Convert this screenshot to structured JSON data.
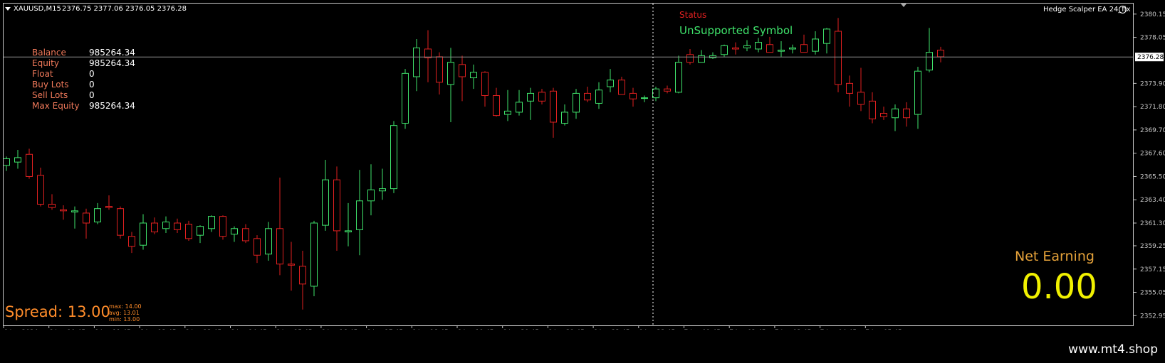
{
  "header": {
    "symbol_timeframe": "XAUUSD,M15",
    "ohlc": "2376.75 2377.06 2376.05 2376.28",
    "ea_name": "Hedge Scalper EA 24_fix"
  },
  "account": {
    "rows": [
      {
        "label": "Balance",
        "value": "985264.34"
      },
      {
        "label": "Equity",
        "value": "985264.34"
      },
      {
        "label": "Float",
        "value": "0"
      },
      {
        "label": "Buy Lots",
        "value": "0"
      },
      {
        "label": "Sell Lots",
        "value": "0"
      },
      {
        "label": "Max Equity",
        "value": "985264.34"
      }
    ]
  },
  "status": {
    "title": "Status",
    "text": "UnSupported Symbol"
  },
  "net_earning": {
    "title": "Net Earning",
    "value": "0.00"
  },
  "spread": {
    "main": "Spread: 13.00",
    "max": "max: 14.00",
    "avg": "avg: 13.01",
    "min": "min: 13.00"
  },
  "watermark": "www.mt4.shop",
  "colors": {
    "bull": "#3fe36b",
    "bear": "#e02020",
    "grid": "#c8c8c8",
    "background": "#000000"
  },
  "chart_data": {
    "type": "candlestick",
    "ylim": [
      2352.2,
      2381.1
    ],
    "y_ticks": [
      "2380.15",
      "2378.05",
      "2376.28",
      "2373.90",
      "2371.80",
      "2369.70",
      "2367.60",
      "2365.50",
      "2363.40",
      "2361.30",
      "2359.25",
      "2357.15",
      "2355.05",
      "2352.95"
    ],
    "current_price": "2376.28",
    "x_ticks": [
      "6 Jun 2024",
      "6 Jun 10:45",
      "6 Jun 11:45",
      "6 Jun 12:45",
      "6 Jun 13:45",
      "6 Jun 14:45",
      "6 Jun 15:45",
      "6 Jun 16:45",
      "6 Jun 17:45",
      "6 Jun 18:45",
      "6 Jun 19:45",
      "6 Jun 20:45",
      "6 Jun 21:45",
      "6 Jun 22:45",
      "6 Jun 23:45",
      "7 Jun 01:45",
      "7 Jun 02:45",
      "7 Jun 03:45",
      "7 Jun 04:45",
      "7 Jun 05:45"
    ],
    "candles": [
      [
        2366.5,
        2367.3,
        2366.0,
        2367.1
      ],
      [
        2366.8,
        2367.9,
        2366.2,
        2367.2
      ],
      [
        2367.5,
        2368.0,
        2365.3,
        2365.5
      ],
      [
        2365.6,
        2366.3,
        2362.8,
        2363.0
      ],
      [
        2363.0,
        2363.9,
        2362.5,
        2362.7
      ],
      [
        2362.5,
        2362.9,
        2361.6,
        2362.4
      ],
      [
        2362.3,
        2362.8,
        2360.8,
        2362.4
      ],
      [
        2362.2,
        2362.6,
        2359.9,
        2361.3
      ],
      [
        2361.4,
        2363.1,
        2361.2,
        2362.6
      ],
      [
        2362.8,
        2363.8,
        2362.5,
        2362.7
      ],
      [
        2362.6,
        2362.8,
        2359.9,
        2360.2
      ],
      [
        2360.1,
        2360.5,
        2358.6,
        2359.2
      ],
      [
        2359.3,
        2362.1,
        2358.9,
        2361.3
      ],
      [
        2361.3,
        2361.8,
        2360.3,
        2360.5
      ],
      [
        2360.8,
        2361.9,
        2360.4,
        2361.4
      ],
      [
        2361.3,
        2361.7,
        2360.4,
        2360.7
      ],
      [
        2361.2,
        2361.5,
        2359.7,
        2359.9
      ],
      [
        2360.2,
        2361.1,
        2359.5,
        2361.0
      ],
      [
        2360.8,
        2362.0,
        2360.5,
        2361.9
      ],
      [
        2361.9,
        2362.0,
        2359.8,
        2360.1
      ],
      [
        2360.3,
        2361.0,
        2359.6,
        2360.8
      ],
      [
        2360.8,
        2361.2,
        2359.5,
        2359.7
      ],
      [
        2359.9,
        2360.2,
        2357.7,
        2358.4
      ],
      [
        2358.5,
        2361.4,
        2357.9,
        2360.8
      ],
      [
        2360.8,
        2365.4,
        2356.6,
        2357.6
      ],
      [
        2357.6,
        2359.6,
        2355.2,
        2357.5
      ],
      [
        2357.4,
        2358.8,
        2353.5,
        2355.8
      ],
      [
        2355.6,
        2361.5,
        2354.7,
        2361.3
      ],
      [
        2361.1,
        2367.0,
        2360.6,
        2365.2
      ],
      [
        2365.2,
        2366.4,
        2358.8,
        2360.6
      ],
      [
        2360.5,
        2363.1,
        2359.2,
        2360.6
      ],
      [
        2360.7,
        2366.1,
        2358.4,
        2363.3
      ],
      [
        2363.3,
        2366.6,
        2362.0,
        2364.3
      ],
      [
        2364.2,
        2366.2,
        2363.4,
        2364.4
      ],
      [
        2364.4,
        2370.5,
        2364.0,
        2370.1
      ],
      [
        2370.3,
        2375.2,
        2369.8,
        2374.8
      ],
      [
        2374.5,
        2377.9,
        2373.2,
        2377.1
      ],
      [
        2377.0,
        2378.7,
        2374.0,
        2376.2
      ],
      [
        2376.3,
        2376.7,
        2372.9,
        2374.0
      ],
      [
        2373.8,
        2377.1,
        2370.4,
        2375.8
      ],
      [
        2375.6,
        2376.4,
        2372.3,
        2374.5
      ],
      [
        2374.4,
        2375.6,
        2373.4,
        2374.9
      ],
      [
        2374.9,
        2375.0,
        2371.8,
        2372.8
      ],
      [
        2372.8,
        2373.5,
        2370.9,
        2371.0
      ],
      [
        2371.1,
        2373.3,
        2370.5,
        2371.4
      ],
      [
        2371.3,
        2373.3,
        2371.0,
        2372.2
      ],
      [
        2372.3,
        2373.5,
        2370.6,
        2373.0
      ],
      [
        2373.1,
        2373.4,
        2372.0,
        2372.3
      ],
      [
        2373.2,
        2373.5,
        2369.0,
        2370.4
      ],
      [
        2370.3,
        2372.0,
        2370.1,
        2371.3
      ],
      [
        2371.3,
        2373.4,
        2370.7,
        2373.0
      ],
      [
        2373.0,
        2373.6,
        2372.2,
        2372.4
      ],
      [
        2372.1,
        2374.0,
        2371.6,
        2373.3
      ],
      [
        2373.6,
        2375.2,
        2373.1,
        2374.2
      ],
      [
        2374.2,
        2374.5,
        2372.9,
        2372.9
      ],
      [
        2373.0,
        2373.5,
        2371.8,
        2372.5
      ],
      [
        2372.6,
        2372.8,
        2372.2,
        2372.6
      ],
      [
        2372.6,
        2373.6,
        2372.3,
        2373.4
      ],
      [
        2373.4,
        2373.7,
        2373.0,
        2373.2
      ],
      [
        2373.1,
        2376.4,
        2373.0,
        2375.8
      ],
      [
        2376.5,
        2377.0,
        2375.6,
        2375.8
      ],
      [
        2375.8,
        2376.9,
        2375.8,
        2376.4
      ],
      [
        2376.2,
        2376.7,
        2376.1,
        2376.4
      ],
      [
        2376.5,
        2377.4,
        2376.3,
        2377.3
      ],
      [
        2377.1,
        2377.6,
        2376.5,
        2377.0
      ],
      [
        2377.1,
        2377.8,
        2376.8,
        2377.3
      ],
      [
        2377.0,
        2378.0,
        2376.7,
        2377.6
      ],
      [
        2377.4,
        2378.1,
        2376.7,
        2376.7
      ],
      [
        2376.8,
        2377.7,
        2376.3,
        2376.9
      ],
      [
        2377.0,
        2377.4,
        2376.6,
        2377.1
      ],
      [
        2377.4,
        2378.3,
        2376.8,
        2376.7
      ],
      [
        2376.8,
        2378.6,
        2376.5,
        2377.9
      ],
      [
        2377.5,
        2378.9,
        2376.6,
        2378.8
      ],
      [
        2378.6,
        2379.8,
        2373.1,
        2373.8
      ],
      [
        2373.9,
        2374.6,
        2371.8,
        2373.0
      ],
      [
        2373.1,
        2375.3,
        2371.4,
        2372.0
      ],
      [
        2372.3,
        2373.1,
        2370.3,
        2370.7
      ],
      [
        2371.2,
        2371.8,
        2370.6,
        2370.9
      ],
      [
        2370.8,
        2372.0,
        2369.6,
        2371.6
      ],
      [
        2371.6,
        2372.2,
        2370.0,
        2370.8
      ],
      [
        2371.1,
        2375.4,
        2369.8,
        2375.0
      ],
      [
        2375.1,
        2378.9,
        2374.9,
        2376.7
      ],
      [
        2376.9,
        2377.2,
        2375.8,
        2376.3
      ]
    ]
  }
}
